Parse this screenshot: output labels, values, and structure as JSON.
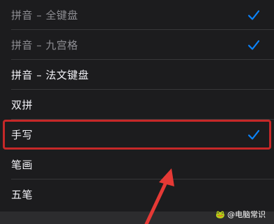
{
  "list": {
    "items": [
      {
        "label": "拼音 – 全键盘",
        "checked": true,
        "dim": true
      },
      {
        "label": "拼音 – 九宫格",
        "checked": true,
        "dim": true
      },
      {
        "label": "拼音 – 法文键盘",
        "checked": false,
        "dim": false
      },
      {
        "label": "双拼",
        "checked": false,
        "dim": false
      },
      {
        "label": "手写",
        "checked": true,
        "dim": false,
        "highlighted": true
      },
      {
        "label": "笔画",
        "checked": false,
        "dim": false
      },
      {
        "label": "五笔",
        "checked": false,
        "dim": false
      }
    ]
  },
  "colors": {
    "background": "#1c1c1e",
    "checkmark": "#0a84ff",
    "highlight_box": "#c62828",
    "arrow": "#e53935"
  },
  "watermark": {
    "logo": "🐸",
    "text": "@电脑常识"
  }
}
